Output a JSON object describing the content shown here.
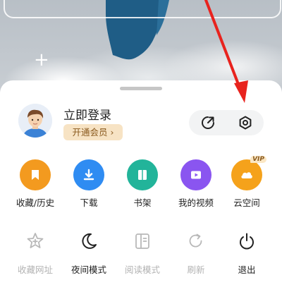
{
  "profile": {
    "login_label": "立即登录",
    "vip_label": "开通会员",
    "vip_chevron": "›"
  },
  "top_icons": [
    "share-icon",
    "settings-icon"
  ],
  "quick_actions": [
    {
      "label": "收藏/历史",
      "icon": "bookmark-icon",
      "color": "#f39a1f"
    },
    {
      "label": "下载",
      "icon": "download-icon",
      "color": "#2f8cf2"
    },
    {
      "label": "书架",
      "icon": "book-icon",
      "color": "#22b49a"
    },
    {
      "label": "我的视频",
      "icon": "play-icon",
      "color": "#8a55f0"
    },
    {
      "label": "云空间",
      "icon": "cloud-icon",
      "color": "#f5a21b",
      "badge": "VIP"
    }
  ],
  "tools": [
    {
      "label": "收藏网址",
      "icon": "star-plus-icon",
      "enabled": false
    },
    {
      "label": "夜间模式",
      "icon": "moon-icon",
      "enabled": true
    },
    {
      "label": "阅读模式",
      "icon": "reader-icon",
      "enabled": false
    },
    {
      "label": "刷新",
      "icon": "refresh-icon",
      "enabled": false
    },
    {
      "label": "退出",
      "icon": "power-icon",
      "enabled": true
    }
  ],
  "colors": {
    "annotation_arrow": "#e8231e",
    "disabled_text": "#b3b3b3",
    "enabled_text": "#222222"
  }
}
